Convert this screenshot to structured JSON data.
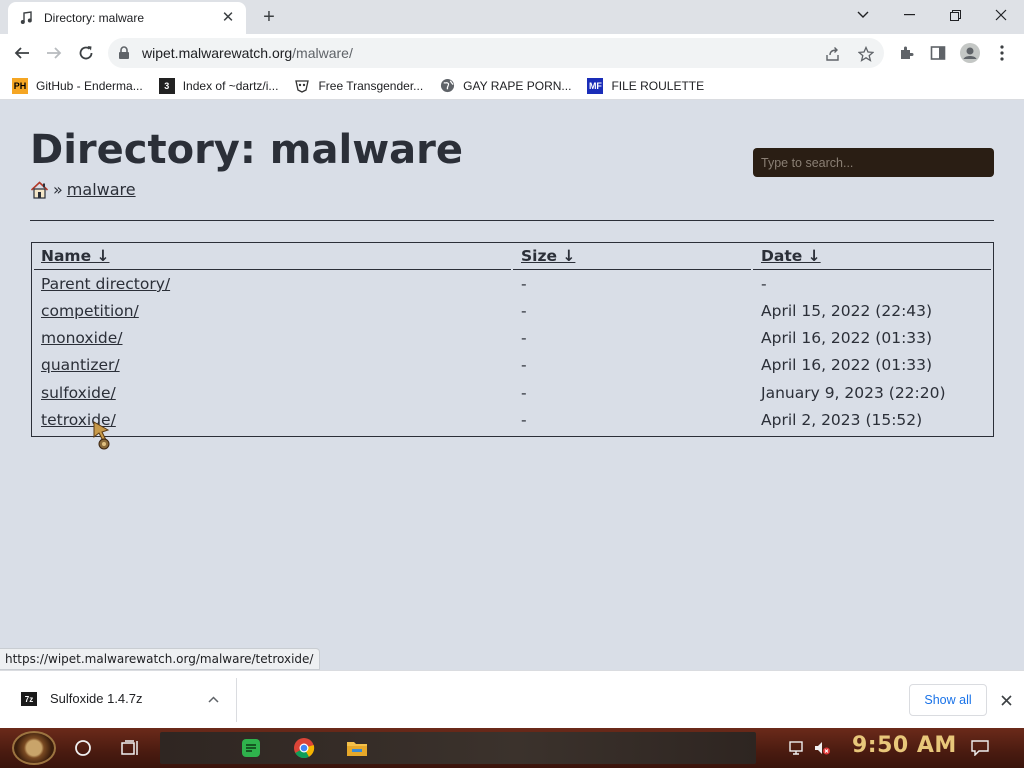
{
  "browser": {
    "tab_title": "Directory: malware",
    "url_host": "wipet.malwarewatch.org",
    "url_path": "/malware/",
    "bookmarks": [
      {
        "icon": "ph-icon",
        "label": "GitHub - Enderma..."
      },
      {
        "icon": "dartz-icon",
        "label": "Index of ~dartz/i..."
      },
      {
        "icon": "mask-icon",
        "label": "Free Transgender..."
      },
      {
        "icon": "globe-icon",
        "label": "GAY RAPE PORN..."
      },
      {
        "icon": "mf-icon",
        "label": "FILE ROULETTE"
      }
    ]
  },
  "page": {
    "title": "Directory: malware",
    "search_placeholder": "Type to search...",
    "breadcrumb": {
      "separator": "»",
      "current": "malware"
    },
    "columns": {
      "name": "Name ↓",
      "size": "Size ↓",
      "date": "Date ↓"
    },
    "rows": [
      {
        "name": "Parent directory/",
        "size": "-",
        "date": "-"
      },
      {
        "name": "competition/",
        "size": "-",
        "date": "April 15, 2022 (22:43)"
      },
      {
        "name": "monoxide/",
        "size": "-",
        "date": "April 16, 2022 (01:33)"
      },
      {
        "name": "quantizer/",
        "size": "-",
        "date": "April 16, 2022 (01:33)"
      },
      {
        "name": "sulfoxide/",
        "size": "-",
        "date": "January 9, 2023 (22:20)"
      },
      {
        "name": "tetroxide/",
        "size": "-",
        "date": "April 2, 2023 (15:52)"
      }
    ]
  },
  "status_url": "https://wipet.malwarewatch.org/malware/tetroxide/",
  "downloads": {
    "file_icon_label": "7z",
    "file_name": "Sulfoxide 1.4.7z",
    "show_all": "Show all"
  },
  "taskbar": {
    "clock": "9:50 AM"
  },
  "colors": {
    "search_bg": "#2a1e14",
    "page_bg": "#d9dee7",
    "text": "#2b2f38",
    "link_blue": "#1a73e8"
  }
}
